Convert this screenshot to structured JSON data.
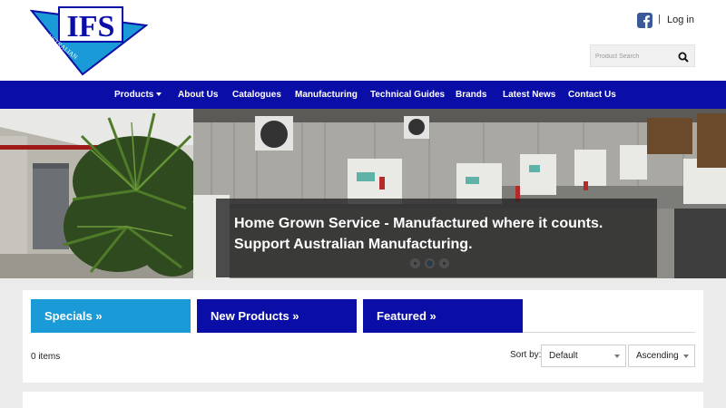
{
  "brand": {
    "logo_text": "IFS",
    "logo_arc_left": "AUSTRALIAN",
    "logo_arc_right": "OWNED"
  },
  "topbar": {
    "divider": "|",
    "login_label": "Log in"
  },
  "search": {
    "placeholder": "Product Search"
  },
  "nav": {
    "items": [
      {
        "label": "Products"
      },
      {
        "label": "About Us"
      },
      {
        "label": "Catalogues"
      },
      {
        "label": "Manufacturing"
      },
      {
        "label": "Technical Guides"
      },
      {
        "label": "Brands"
      },
      {
        "label": "Latest News"
      },
      {
        "label": "Contact Us"
      }
    ]
  },
  "hero": {
    "caption_line1": "Home Grown Service - Manufactured where it counts.",
    "caption_line2": "Support Australian Manufacturing.",
    "slide_count": 3,
    "active_slide": 2
  },
  "tabs": [
    {
      "label": "Specials »"
    },
    {
      "label": "New Products »"
    },
    {
      "label": "Featured »"
    }
  ],
  "listing": {
    "items_count": "0 items",
    "sort_label": "Sort by:",
    "sort_field": "Default",
    "sort_order": "Ascending"
  },
  "colors": {
    "nav_blue": "#0a0ea6",
    "specials_tab": "#1a9ad6",
    "tab_dark": "#0a0ea6",
    "facebook": "#3b5998"
  }
}
